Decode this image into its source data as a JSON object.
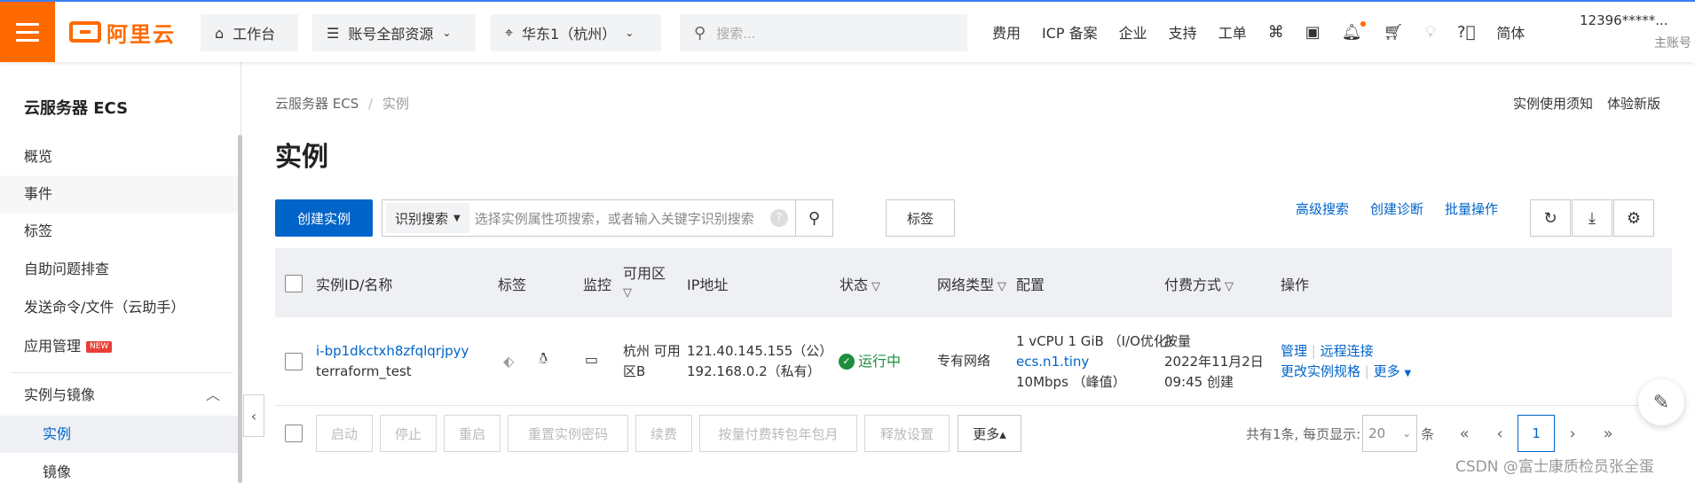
{
  "topbar": {
    "brand": "阿里云",
    "workbench": "工作台",
    "resources": "账号全部资源",
    "region": "华东1（杭州）",
    "search_placeholder": "搜索...",
    "links": [
      "费用",
      "ICP 备案",
      "企业",
      "支持",
      "工单"
    ],
    "lang": "简体",
    "account": "12396*****...",
    "account_role": "主账号"
  },
  "sidebar": {
    "title": "云服务器 ECS",
    "items": [
      "概览",
      "事件",
      "标签",
      "自助问题排查",
      "发送命令/文件（云助手）",
      "应用管理"
    ],
    "new_badge": "NEW",
    "group": "实例与镜像",
    "sub_items": [
      "实例",
      "镜像"
    ]
  },
  "breadcrumb": {
    "root": "云服务器 ECS",
    "sep": "/",
    "current": "实例"
  },
  "page": {
    "title": "实例",
    "top_links": [
      "实例使用须知",
      "体验新版"
    ]
  },
  "toolbar": {
    "create": "创建实例",
    "search_type": "识别搜索",
    "search_placeholder": "选择实例属性项搜索，或者输入关键字识别搜索",
    "tag": "标签",
    "advanced": "高级搜索",
    "diagnose": "创建诊断",
    "batch": "批量操作"
  },
  "table": {
    "headers": [
      "实例ID/名称",
      "标签",
      "监控",
      "可用区",
      "IP地址",
      "状态",
      "网络类型",
      "配置",
      "付费方式",
      "操作"
    ],
    "rows": [
      {
        "id": "i-bp1dkctxh8zfqlqrjpyy",
        "name": "terraform_test",
        "zone_1": "杭州 可用",
        "zone_2": "区B",
        "ip_public": "121.40.145.155（公）",
        "ip_private": "192.168.0.2（私有）",
        "status": "运行中",
        "network": "专有网络",
        "config_1": "1 vCPU 1 GiB （I/O优化）",
        "config_2": "ecs.n1.tiny",
        "config_3": "10Mbps （峰值）",
        "billing_1": "按量",
        "billing_2": "2022年11月2日",
        "billing_3": "09:45 创建",
        "actions": [
          "管理",
          "远程连接",
          "更改实例规格",
          "更多"
        ]
      }
    ]
  },
  "footer": {
    "buttons": [
      "启动",
      "停止",
      "重启",
      "重置实例密码",
      "续费",
      "按量付费转包年包月",
      "释放设置"
    ],
    "more": "更多▴",
    "summary": "共有1条, 每页显示:",
    "page_size": "20",
    "unit": "条",
    "current_page": "1"
  },
  "watermark": "CSDN @富士康质检员张全蛋"
}
